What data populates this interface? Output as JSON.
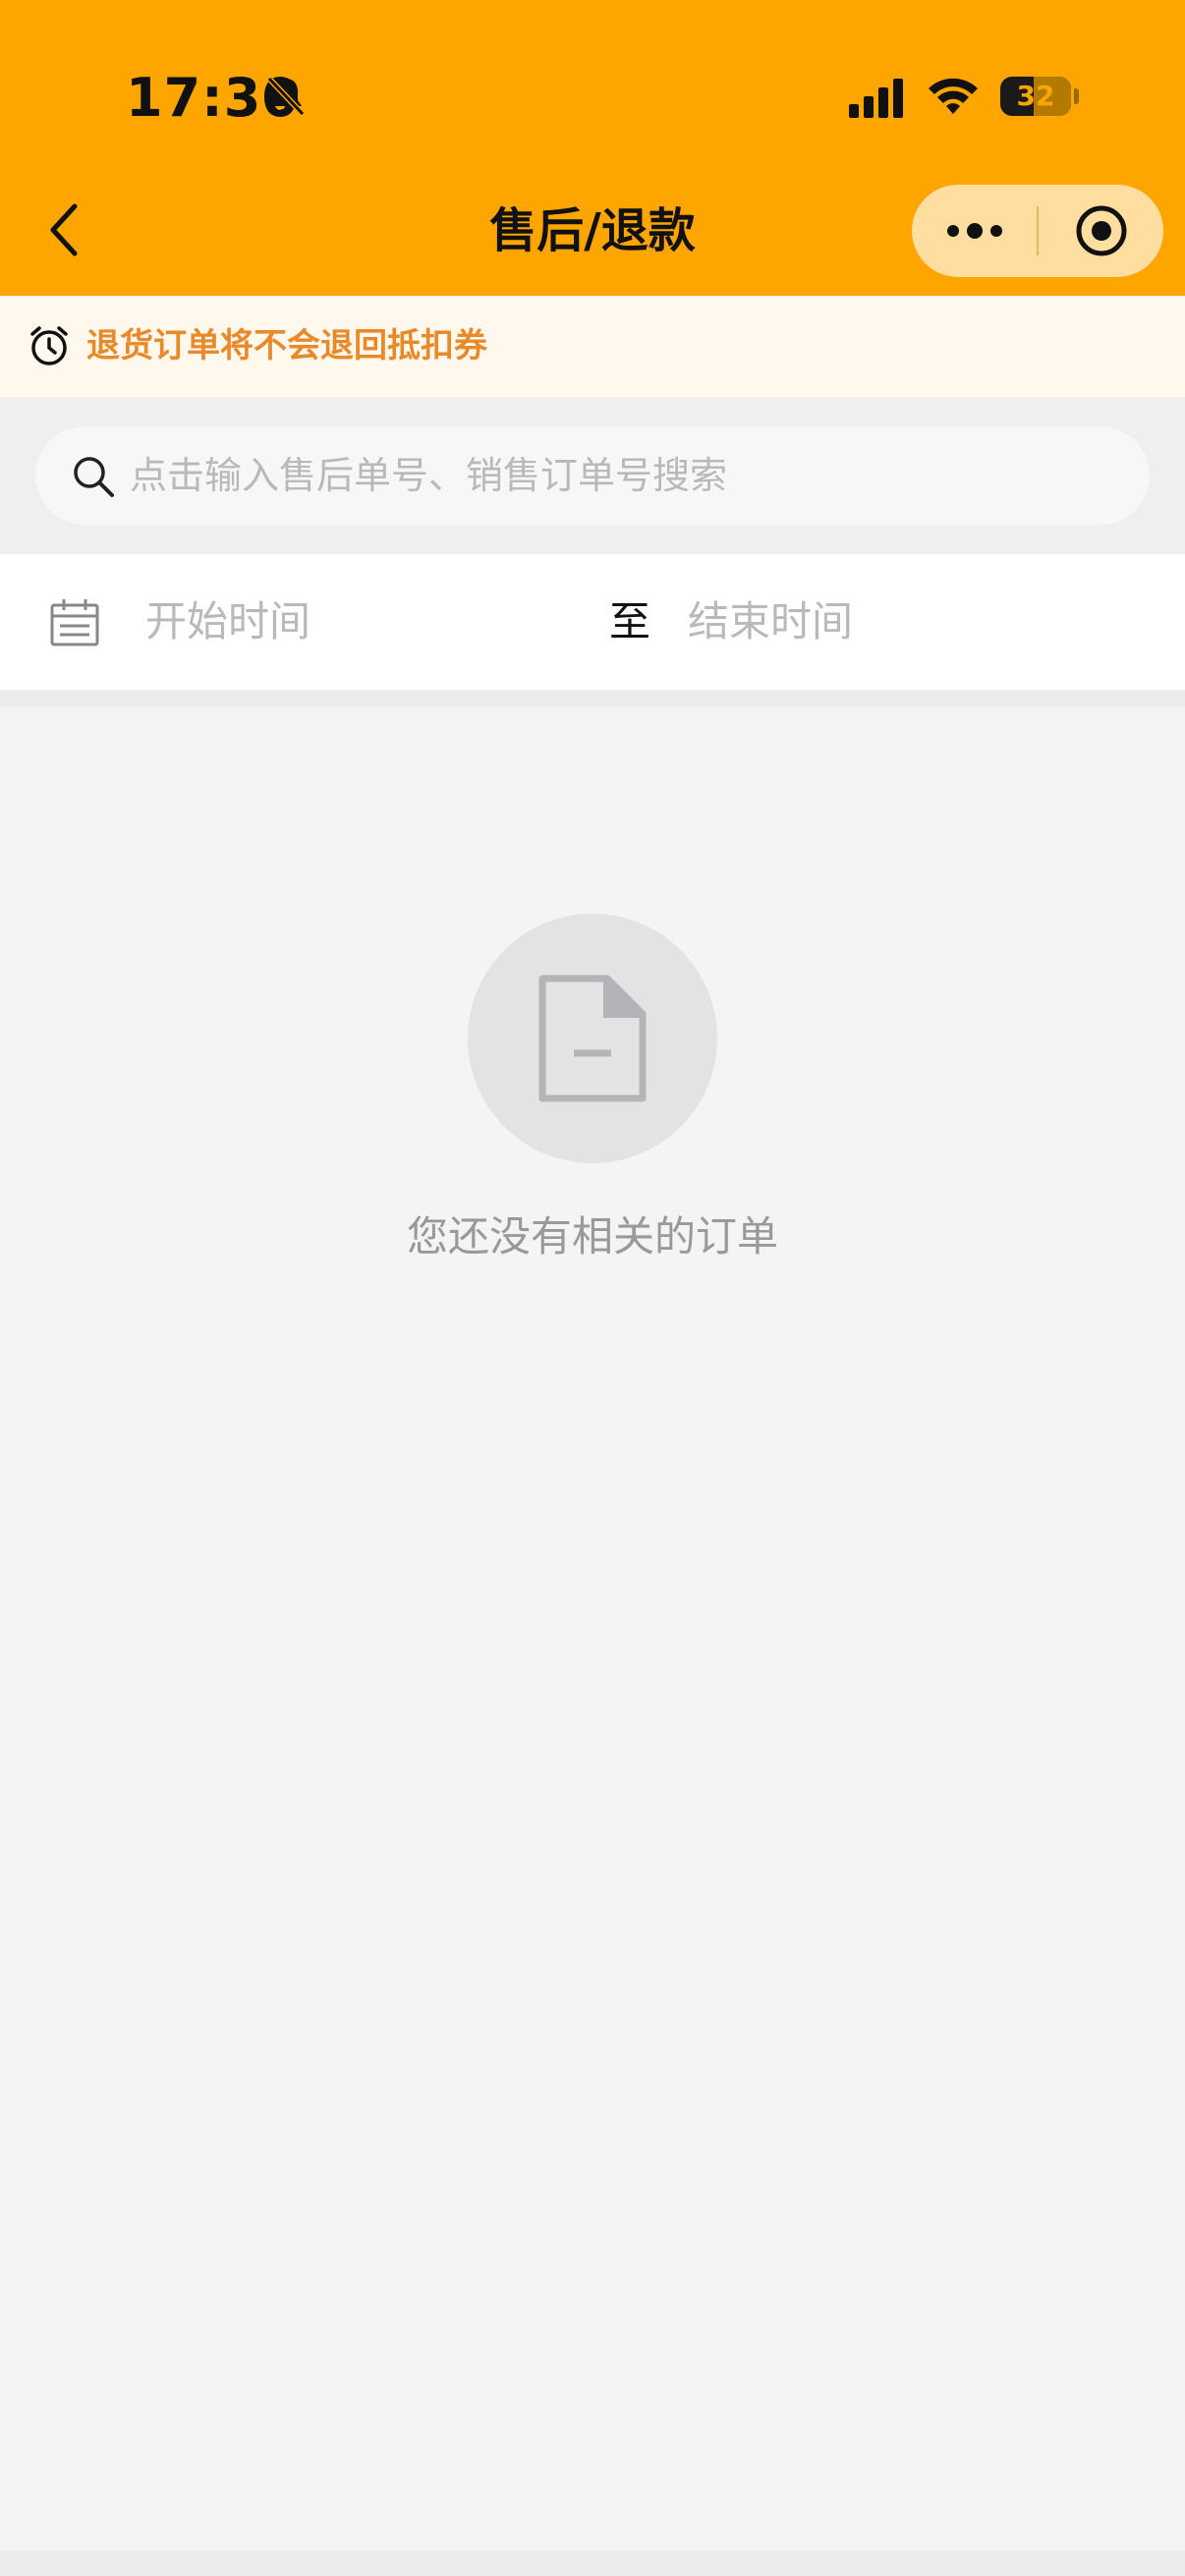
{
  "status_bar": {
    "time": "17:30",
    "battery": "32",
    "icons": [
      "bell-slash-icon",
      "cellular-signal-icon",
      "wifi-icon",
      "battery-icon"
    ]
  },
  "nav": {
    "title": "售后/退款",
    "back_icon": "chevron-left-icon",
    "more_icon": "more-dots-icon",
    "close_icon": "target-circle-icon"
  },
  "notice": {
    "icon": "alarm-clock-icon",
    "text": "退货订单将不会退回抵扣券"
  },
  "search": {
    "icon": "search-icon",
    "placeholder": "点击输入售后单号、销售订单号搜索",
    "value": ""
  },
  "date_filter": {
    "icon": "calendar-icon",
    "start_placeholder": "开始时间",
    "separator": "至",
    "end_placeholder": "结束时间"
  },
  "empty_state": {
    "icon": "empty-document-icon",
    "message": "您还没有相关的订单"
  },
  "colors": {
    "header_bg": "#ffa500",
    "capsule_bg": "#ffdea0",
    "notice_bg": "#fff8ed",
    "notice_text": "#e88a2a",
    "page_bg": "#f4f4f4",
    "placeholder_text": "#b9b9b9",
    "empty_text": "#999999"
  }
}
